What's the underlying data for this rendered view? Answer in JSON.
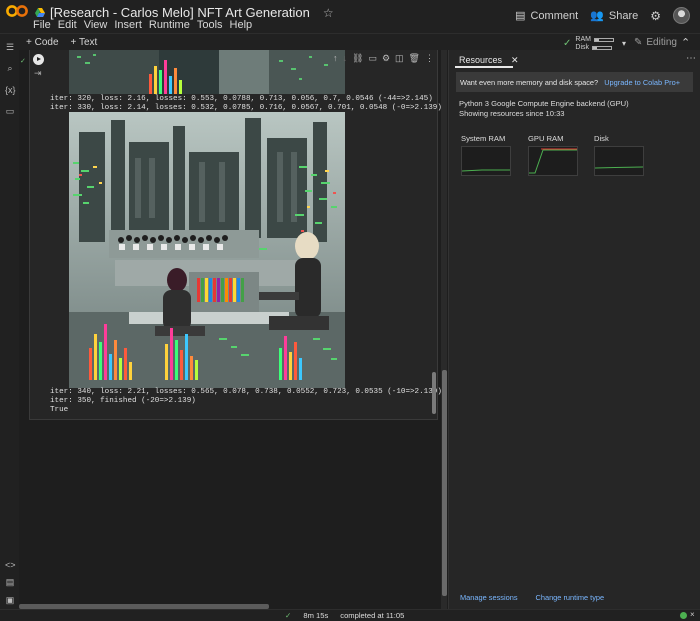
{
  "header": {
    "doc_title": "[Research - Carlos Melo] NFT Art Generation",
    "menu": [
      "File",
      "Edit",
      "View",
      "Insert",
      "Runtime",
      "Tools",
      "Help"
    ],
    "comment_label": "Comment",
    "share_label": "Share"
  },
  "toolbar": {
    "code_label": "+ Code",
    "text_label": "+ Text",
    "ram_label": "RAM",
    "disk_label": "Disk",
    "ram_fraction": 0.25,
    "disk_fraction": 0.2,
    "editing_label": "Editing"
  },
  "output": {
    "line_top_1": "iter: 320, loss: 2.16, losses: 0.553, 0.0788, 0.713, 0.056, 0.7, 0.0546 (-44=>2.145)",
    "line_top_2": "iter: 330, loss: 2.14, losses: 0.532, 0.0785, 0.716, 0.0567, 0.701, 0.0548 (-0=>2.139)",
    "line_bot_1": "iter: 340, loss: 2.21, losses: 0.565, 0.078, 0.738, 0.0552, 0.723, 0.0535 (-10=>2.139)",
    "line_bot_2": "iter: 350, finished (-20=>2.139)",
    "line_bot_3": "True"
  },
  "resources": {
    "tab_label": "Resources",
    "upgrade_text": "Want even more memory and disk space?",
    "upgrade_link": "Upgrade to Colab Pro+",
    "backend_line": "Python 3 Google Compute Engine backend (GPU)",
    "since_line": "Showing resources since 10:33",
    "gauges": [
      "System RAM",
      "GPU RAM",
      "Disk"
    ],
    "manage_sessions": "Manage sessions",
    "change_runtime": "Change runtime type"
  },
  "status": {
    "duration": "8m 15s",
    "completed": "completed at 11:05"
  },
  "colors": {
    "accent_link": "#7ab7ff",
    "ok_green": "#6fbf73",
    "gpu_red": "#e53935"
  }
}
